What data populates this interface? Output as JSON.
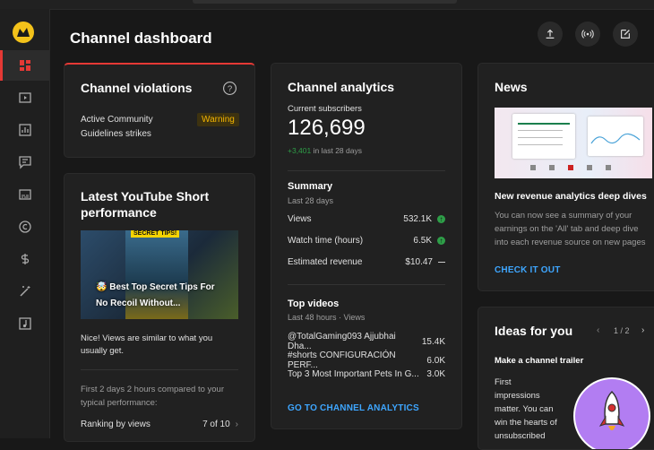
{
  "page": {
    "title": "Channel dashboard"
  },
  "violations": {
    "title": "Channel violations",
    "label_line1": "Active Community",
    "label_line2": "Guidelines strikes",
    "status": "Warning"
  },
  "short": {
    "title_line1": "Latest YouTube Short",
    "title_line2": "performance",
    "thumb_banner": "SECRET TIPS!",
    "thumb_caption_line1": "🤯 Best Top Secret Tips For",
    "thumb_caption_line2": "No Recoil Without...",
    "note_line1": "Nice! Views are similar to what you",
    "note_line2": "usually get.",
    "compare_line1": "First 2 days 2 hours compared to your",
    "compare_line2": "typical performance:",
    "ranking_label": "Ranking by views",
    "ranking_value": "7 of 10"
  },
  "analytics": {
    "title": "Channel analytics",
    "subs_label": "Current subscribers",
    "subs_value": "126,699",
    "subs_change": "+3,401",
    "subs_change_period": "in last 28 days",
    "summary_title": "Summary",
    "summary_period": "Last 28 days",
    "rows": [
      {
        "label": "Views",
        "value": "532.1K"
      },
      {
        "label": "Watch time (hours)",
        "value": "6.5K"
      },
      {
        "label": "Estimated revenue",
        "value": "$10.47"
      }
    ],
    "top_title": "Top videos",
    "top_period": "Last 48 hours · Views",
    "videos": [
      {
        "title": "@TotalGaming093 Ajjubhai Dha...",
        "views": "15.4K"
      },
      {
        "title": "#shorts CONFIGURACIÓN PERF...",
        "views": "6.0K"
      },
      {
        "title": "Top 3 Most Important Pets In G...",
        "views": "3.0K"
      }
    ],
    "link": "GO TO CHANNEL ANALYTICS"
  },
  "news": {
    "title": "News",
    "headline": "New revenue analytics deep dives",
    "body_line1": "You can now see a summary of your",
    "body_line2": "earnings on the 'All' tab and deep dive",
    "body_line3": "into each revenue source on new pages",
    "link": "CHECK IT OUT"
  },
  "ideas": {
    "title": "Ideas for you",
    "pager": "1 / 2",
    "subtitle": "Make a channel trailer",
    "body": [
      "First",
      "impressions",
      "matter. You can",
      "win the hearts of",
      "unsubscribed"
    ]
  },
  "colors": {
    "accent": "#3ea6ff",
    "active": "#e53935",
    "positive": "#2e9e48",
    "warning": "#f2b400"
  }
}
